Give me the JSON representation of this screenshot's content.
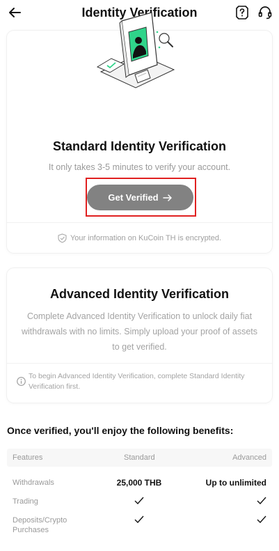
{
  "header": {
    "title": "Identity Verification",
    "back_icon": "arrow-left-icon",
    "help_icon": "question-box-icon",
    "support_icon": "headset-icon"
  },
  "standard": {
    "title": "Standard Identity Verification",
    "subtitle": "It only takes 3-5 minutes to verify your account.",
    "button_label": "Get Verified",
    "button_icon": "arrow-right-icon",
    "encryption_note": "Your information on KuCoin TH is encrypted."
  },
  "advanced": {
    "title": "Advanced Identity Verification",
    "description": "Complete Advanced Identity Verification to unlock daily fiat withdrawals with no limits. Simply upload your proof of assets to get verified.",
    "note": "To begin Advanced Identity Verification, complete Standard Identity Verification first."
  },
  "benefits": {
    "title": "Once verified, you'll enjoy the following benefits:",
    "headers": [
      "Features",
      "Standard",
      "Advanced"
    ],
    "rows": [
      {
        "feature": "Withdrawals",
        "standard": "25,000 THB",
        "advanced": "Up to unlimited"
      },
      {
        "feature": "Trading",
        "standard": "check",
        "advanced": "check"
      },
      {
        "feature": "Deposits/Crypto Purchases",
        "standard": "check",
        "advanced": "check"
      }
    ]
  },
  "colors": {
    "accent_green": "#2fd48a",
    "button_gray": "#828282",
    "highlight_red": "#e02020"
  }
}
